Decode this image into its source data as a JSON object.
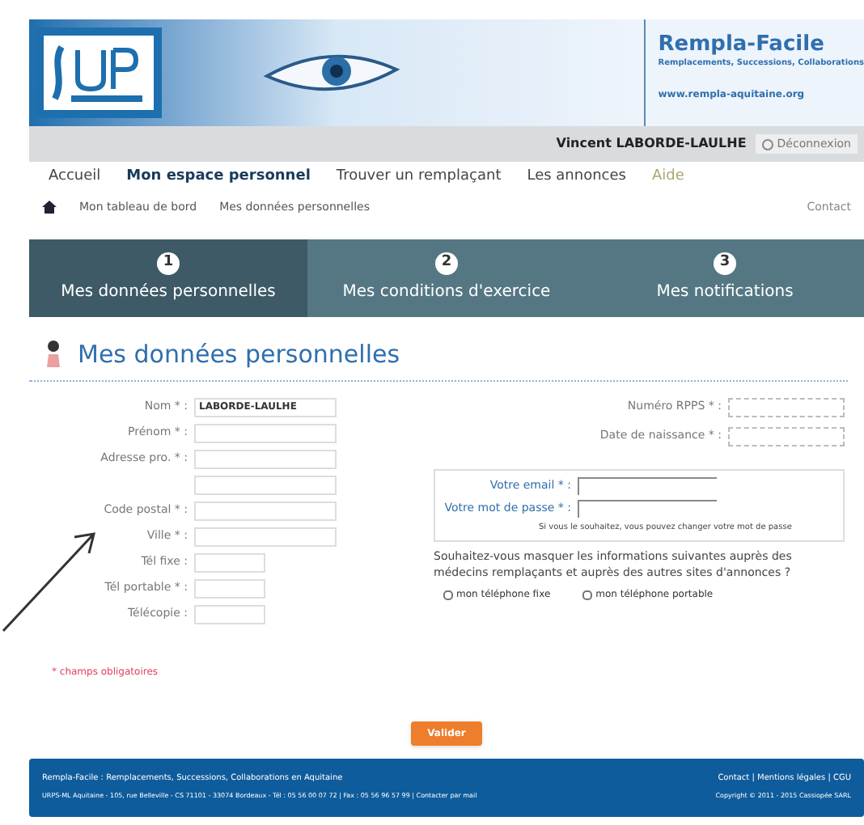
{
  "header": {
    "site_title": "Rempla-Facile",
    "tagline": "Remplacements, Successions, Collaborations",
    "url": "www.rempla-aquitaine.org"
  },
  "user_bar": {
    "user": "Vincent LABORDE-LAULHE",
    "logout": "Déconnexion"
  },
  "nav": [
    {
      "label": "Accueil",
      "selected": false
    },
    {
      "label": "Mon espace personnel",
      "selected": true
    },
    {
      "label": "Trouver un remplaçant",
      "selected": false
    },
    {
      "label": "Les annonces",
      "selected": false
    },
    {
      "label": "Aide",
      "selected": false
    }
  ],
  "breadcrumb": {
    "items": [
      "Mon tableau de bord",
      "Mes données personnelles"
    ],
    "right_link": "Contact"
  },
  "steps": [
    {
      "number": "1",
      "label": "Mes données personnelles",
      "selected": true
    },
    {
      "number": "2",
      "label": "Mes conditions d'exercice",
      "selected": false
    },
    {
      "number": "3",
      "label": "Mes notifications",
      "selected": false
    }
  ],
  "page_title": "Mes données personnelles",
  "left_fields": [
    {
      "label": "Nom * :",
      "value": "LABORDE-LAULHE",
      "kind": "wide"
    },
    {
      "label": "Prénom * :",
      "kind": "wide"
    },
    {
      "label": "Adresse pro. * :",
      "kind": "wide"
    },
    {
      "kind": "wide"
    },
    {
      "label": "Code postal * :",
      "kind": "wide"
    },
    {
      "label": "Ville * :",
      "kind": "wide"
    },
    {
      "label": "Tél fixe :",
      "kind": "short"
    },
    {
      "label": "Tél portable * :",
      "kind": "short"
    },
    {
      "label": "Télécopie :",
      "kind": "short"
    }
  ],
  "right_fields": [
    {
      "label": "Numéro RPPS * :"
    },
    {
      "label": "Date de naissance * :"
    }
  ],
  "account": {
    "fields": [
      {
        "label": "Votre email * :"
      },
      {
        "label": "Votre mot de passe * :"
      }
    ],
    "hint": "Si vous le souhaitez, vous pouvez changer votre mot de passe"
  },
  "privacy_question": "Souhaitez-vous masquer les informations suivantes auprès des médecins remplaçants et auprès des autres sites d'annonces ?",
  "privacy_options": [
    {
      "label": "mon téléphone fixe",
      "checked": false
    },
    {
      "label": "mon téléphone portable",
      "checked": false
    }
  ],
  "required_note": "* champs obligatoires",
  "submit": "Valider",
  "footer": {
    "line1": "Rempla-Facile : Remplacements, Successions, Collaborations en Aquitaine",
    "line2": "URPS-ML Aquitaine - 105, rue Belleville - CS 71101 - 33074 Bordeaux - Tél : 05 56 00 07 72 | Fax : 05 56 96 57 99 | Contacter par mail",
    "links": "Contact | Mentions légales | CGU",
    "copyright": "Copyright © 2011 - 2015 Cassiopée SARL"
  }
}
